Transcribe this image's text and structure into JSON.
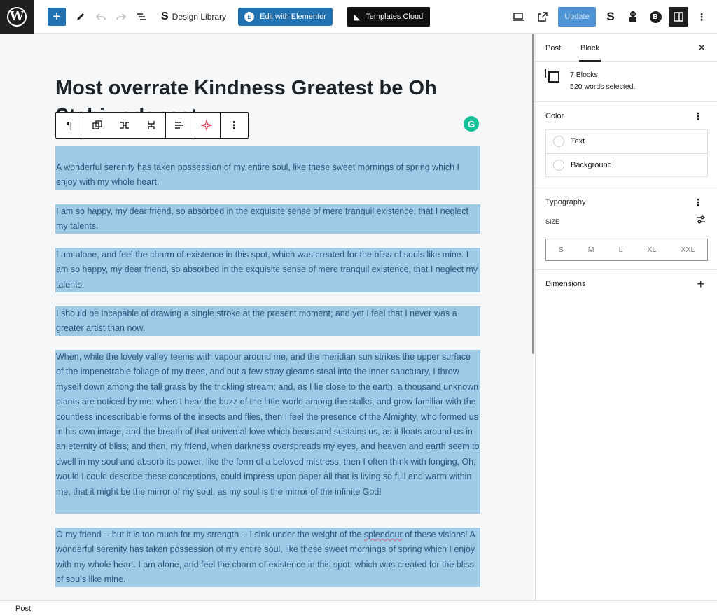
{
  "toolbar": {
    "add_label": "+",
    "design_library_label": "Design Library",
    "elementor_label": "Edit with Elementor",
    "templates_label": "Templates Cloud",
    "update_label": "Update"
  },
  "editor": {
    "title": "Most overrate Kindness Greatest be Oh Stahiwadanaat",
    "paragraphs": [
      "A wonderful serenity has taken possession of my entire soul, like these sweet mornings of spring which I enjoy with my whole heart.",
      " I am so happy, my dear friend, so absorbed in the exquisite sense of mere tranquil existence, that I neglect my talents.",
      "I am alone, and feel the charm of existence in this spot, which was created for the bliss of souls like mine. I am so happy, my dear friend, so absorbed in the exquisite sense of mere tranquil existence, that I neglect my talents.",
      "I should be incapable of drawing a single stroke at the present moment; and yet I feel that I never was a greater artist than now.",
      "When, while the lovely valley teems with vapour around me, and the meridian sun strikes the upper surface of the impenetrable foliage of my trees, and but a few stray gleams steal into the inner sanctuary, I throw myself down among the tall grass by the trickling stream; and, as I lie close to the earth, a thousand unknown plants are noticed by me: when I hear the buzz of the little world among the stalks, and grow familiar with the countless indescribable forms of the insects and flies, then I feel the presence of the Almighty, who formed us in his own image, and the breath of that universal love which bears and sustains us, as it floats around us in an eternity of bliss; and then, my friend, when darkness overspreads my eyes, and heaven and earth seem to dwell in my soul and absorb its power, like the form of a beloved mistress, then I often think with longing, Oh, would I could describe these conceptions, could impress upon paper all that is living so full and warm within me, that it might be the mirror of my soul, as my soul is the mirror of the infinite God!"
    ],
    "para7_before": "O my friend -- but it is too much for my strength -- I sink under the weight of the ",
    "para7_underlined": "splendour",
    "para7_after": " of these visions! A wonderful serenity has taken possession of my entire soul, like these sweet mornings of spring which I enjoy with my whole heart. I am alone, and feel the charm of existence in this spot, which was created for the bliss of souls like mine."
  },
  "sidebar": {
    "tab_post": "Post",
    "tab_block": "Block",
    "blocks_count": "7 Blocks",
    "words_selected": "520 words selected.",
    "color_title": "Color",
    "color_text": "Text",
    "color_background": "Background",
    "typography_title": "Typography",
    "size_label": "SIZE",
    "sizes": [
      "S",
      "M",
      "L",
      "XL",
      "XXL"
    ],
    "dimensions_title": "Dimensions"
  },
  "footer": {
    "breadcrumb": "Post"
  }
}
